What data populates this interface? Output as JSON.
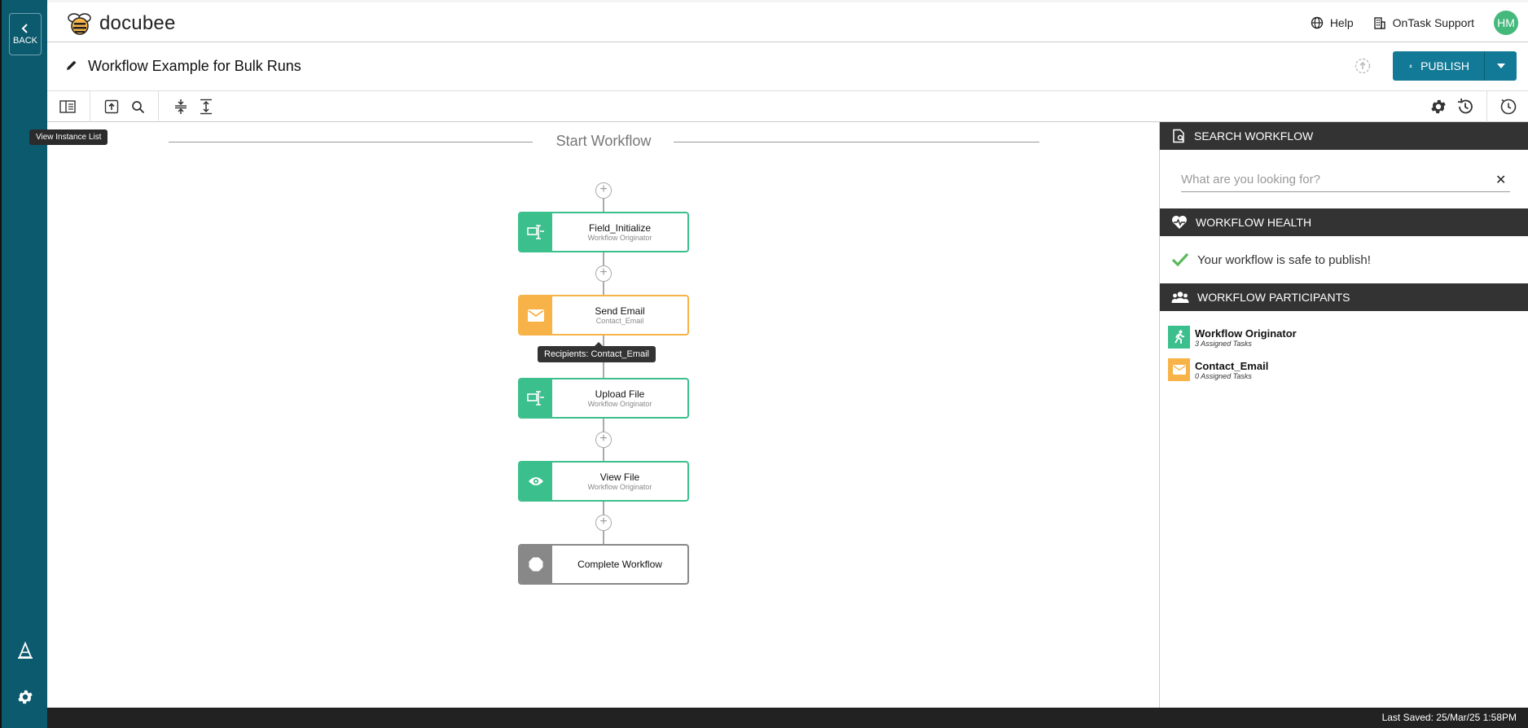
{
  "rail": {
    "back_label": "BACK",
    "tooltip": "View Instance List"
  },
  "header": {
    "logo_text": "docubee",
    "help_label": "Help",
    "org_label": "OnTask Support",
    "avatar_initials": "HM"
  },
  "titlebar": {
    "workflow_title": "Workflow Example for Bulk Runs",
    "publish_label": "PUBLISH"
  },
  "canvas": {
    "start_label": "Start Workflow",
    "steps": [
      {
        "title": "Field_Initialize",
        "subtitle": "Workflow Originator",
        "type": "form",
        "color": "#3bbf8c"
      },
      {
        "title": "Send Email",
        "subtitle": "Contact_Email",
        "type": "email",
        "color": "#f7b347"
      },
      {
        "title": "Upload File",
        "subtitle": "Workflow Originator",
        "type": "form",
        "color": "#3bbf8c"
      },
      {
        "title": "View File",
        "subtitle": "Workflow Originator",
        "type": "view",
        "color": "#3bbf8c"
      },
      {
        "title": "Complete Workflow",
        "subtitle": "",
        "type": "end",
        "color": "#888888"
      }
    ],
    "recipients_tooltip": "Recipients: Contact_Email"
  },
  "sidepanel": {
    "search_heading": "SEARCH WORKFLOW",
    "search_placeholder": "What are you looking for?",
    "health_heading": "WORKFLOW HEALTH",
    "health_message": "Your workflow is safe to publish!",
    "participants_heading": "WORKFLOW PARTICIPANTS",
    "participants": [
      {
        "name": "Workflow Originator",
        "tasks": "3 Assigned Tasks",
        "color": "#3bbf8c"
      },
      {
        "name": "Contact_Email",
        "tasks": "0 Assigned Tasks",
        "color": "#f7b347"
      }
    ]
  },
  "footer": {
    "last_saved": "Last Saved: 25/Mar/25 1:58PM"
  },
  "colors": {
    "rail": "#0c5a6e",
    "accent": "#127a96",
    "green_step": "#3bbf8c",
    "orange_step": "#f7b347",
    "health_ok": "#5cb85c"
  }
}
